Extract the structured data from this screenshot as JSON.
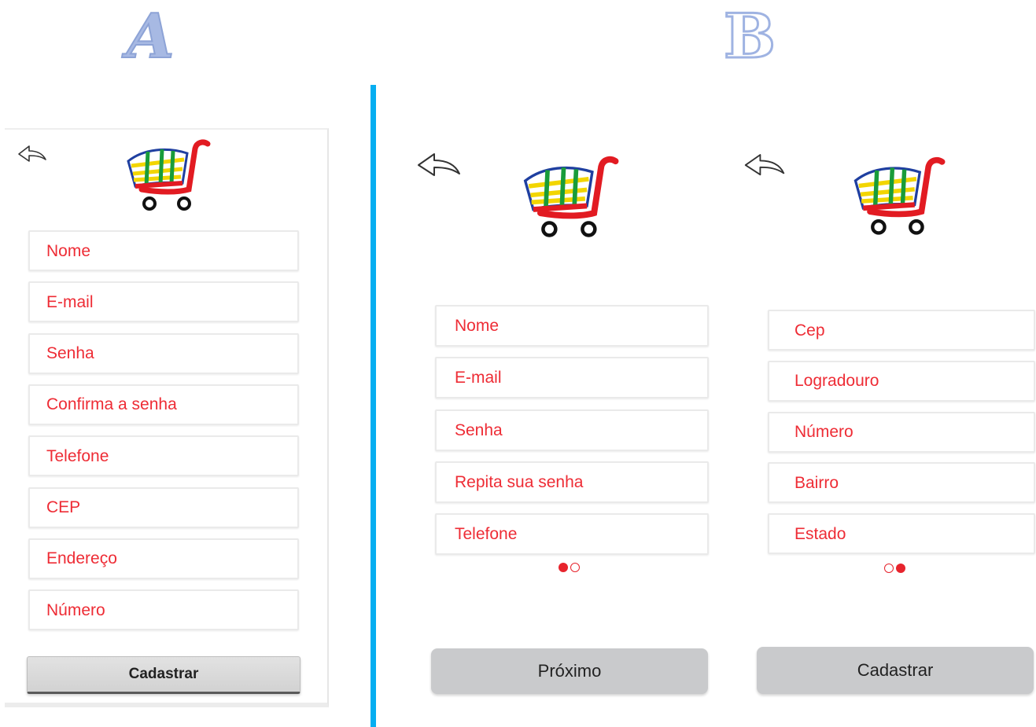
{
  "labels": {
    "a": "A",
    "b": "B"
  },
  "colors": {
    "field_text": "#ee2c35",
    "divider": "#06aef1",
    "dot_active": "#e7242d",
    "button": "#c9cacc"
  },
  "icons": {
    "back": "back-arrow-icon",
    "logo": "shopping-cart-logo"
  },
  "version_a": {
    "fields": [
      "Nome",
      "E-mail",
      "Senha",
      "Confirma a senha",
      "Telefone",
      "CEP",
      "Endereço",
      "Número"
    ],
    "button": "Cadastrar"
  },
  "version_b": {
    "step1": {
      "fields": [
        "Nome",
        "E-mail",
        "Senha",
        "Repita sua senha",
        "Telefone"
      ],
      "button": "Próximo",
      "page_indicator": {
        "current": 1,
        "total": 2
      }
    },
    "step2": {
      "fields": [
        "Cep",
        "Logradouro",
        "Número",
        "Bairro",
        "Estado"
      ],
      "button": "Cadastrar",
      "page_indicator": {
        "current": 2,
        "total": 2
      }
    }
  }
}
